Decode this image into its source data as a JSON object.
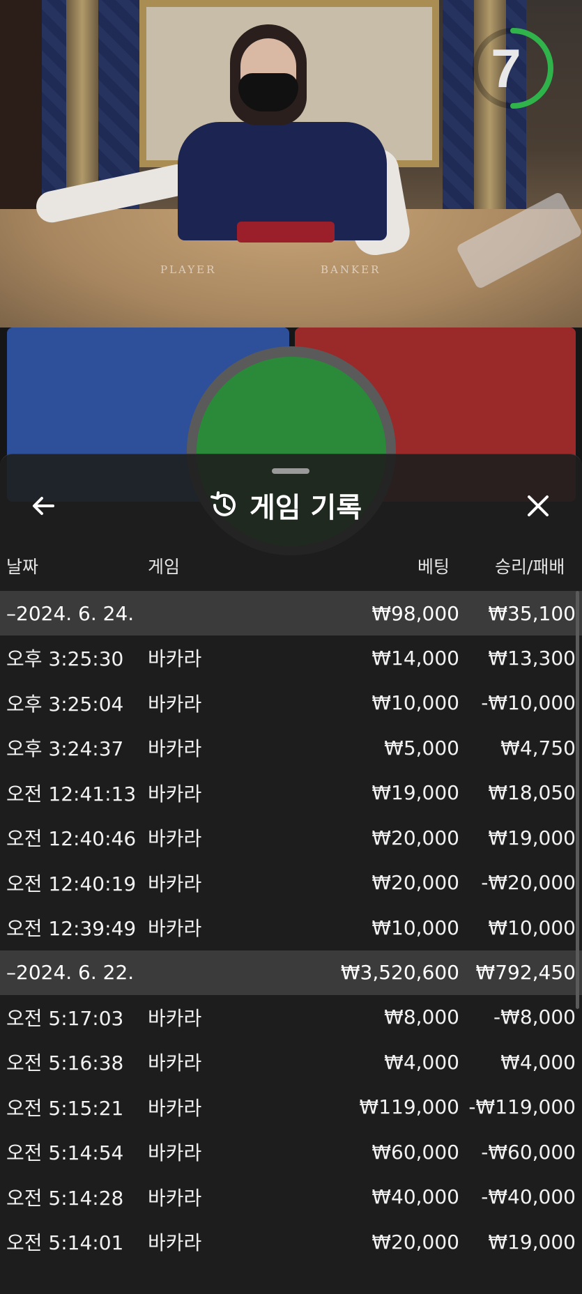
{
  "video": {
    "timer_value": "7",
    "table_labels": {
      "player": "PLAYER",
      "banker": "BANKER"
    }
  },
  "history": {
    "title": "게임 기록",
    "columns": {
      "date": "날짜",
      "game": "게임",
      "bet": "베팅",
      "win_loss": "승리/패배"
    },
    "groups": [
      {
        "date": "–2024. 6. 24.",
        "bet": "₩98,000",
        "win_loss": "₩35,100",
        "rows": [
          {
            "time": "오후 3:25:30",
            "game": "바카라",
            "bet": "₩14,000",
            "win_loss": "₩13,300"
          },
          {
            "time": "오후 3:25:04",
            "game": "바카라",
            "bet": "₩10,000",
            "win_loss": "-₩10,000"
          },
          {
            "time": "오후 3:24:37",
            "game": "바카라",
            "bet": "₩5,000",
            "win_loss": "₩4,750"
          },
          {
            "time": "오전 12:41:13",
            "game": "바카라",
            "bet": "₩19,000",
            "win_loss": "₩18,050"
          },
          {
            "time": "오전 12:40:46",
            "game": "바카라",
            "bet": "₩20,000",
            "win_loss": "₩19,000"
          },
          {
            "time": "오전 12:40:19",
            "game": "바카라",
            "bet": "₩20,000",
            "win_loss": "-₩20,000"
          },
          {
            "time": "오전 12:39:49",
            "game": "바카라",
            "bet": "₩10,000",
            "win_loss": "₩10,000"
          }
        ]
      },
      {
        "date": "–2024. 6. 22.",
        "bet": "₩3,520,600",
        "win_loss": "₩792,450",
        "rows": [
          {
            "time": "오전 5:17:03",
            "game": "바카라",
            "bet": "₩8,000",
            "win_loss": "-₩8,000"
          },
          {
            "time": "오전 5:16:38",
            "game": "바카라",
            "bet": "₩4,000",
            "win_loss": "₩4,000"
          },
          {
            "time": "오전 5:15:21",
            "game": "바카라",
            "bet": "₩119,000",
            "win_loss": "-₩119,000"
          },
          {
            "time": "오전 5:14:54",
            "game": "바카라",
            "bet": "₩60,000",
            "win_loss": "-₩60,000"
          },
          {
            "time": "오전 5:14:28",
            "game": "바카라",
            "bet": "₩40,000",
            "win_loss": "-₩40,000"
          },
          {
            "time": "오전 5:14:01",
            "game": "바카라",
            "bet": "₩20,000",
            "win_loss": "₩19,000"
          }
        ]
      }
    ]
  },
  "icons": {
    "back": "arrow-left-icon",
    "history": "history-clock-icon",
    "close": "close-x-icon"
  },
  "colors": {
    "timer_ring": "#2fb34a",
    "group_band": "#3b3b3b",
    "sheet_bg": "#1e1e1e"
  }
}
